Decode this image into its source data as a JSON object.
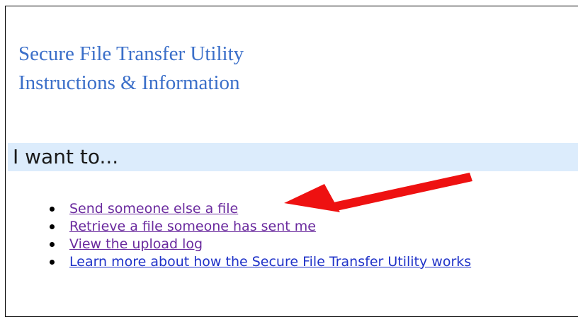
{
  "page": {
    "title_line1": "Secure File Transfer Utility",
    "title_line2": "Instructions & Information"
  },
  "section": {
    "heading": "I want to..."
  },
  "links": [
    {
      "label": "Send someone else a file",
      "visited": true
    },
    {
      "label": "Retrieve a file someone has sent me",
      "visited": true
    },
    {
      "label": "View the upload log",
      "visited": true
    },
    {
      "label": "Learn more about how the Secure File Transfer Utility works",
      "visited": false
    }
  ],
  "annotation": {
    "icon": "red-arrow-icon",
    "color": "#ee1111",
    "points_to": "Send someone else a file"
  },
  "colors": {
    "title": "#3b6fc9",
    "section_bar": "#dcecfc",
    "visited_link": "#6a2a9e",
    "unvisited_link": "#1f32c8"
  }
}
